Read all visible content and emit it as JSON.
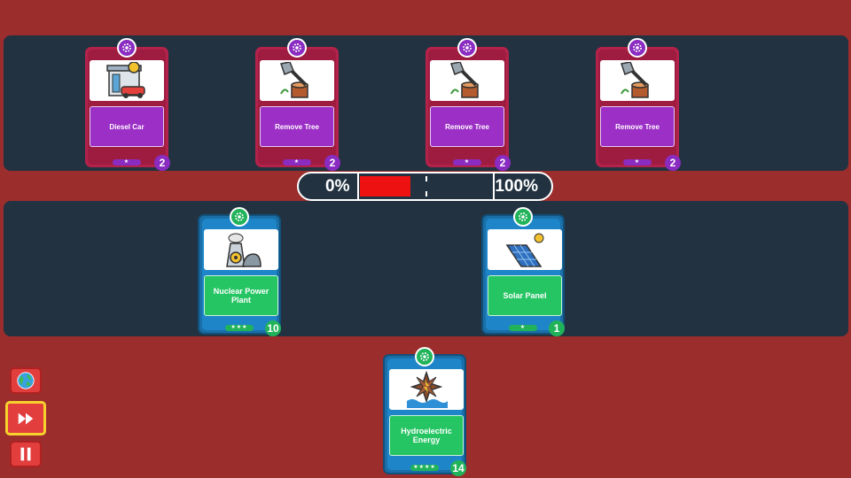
{
  "enemy_cards": [
    {
      "title": "Diesel Car",
      "icon": "diesel-car-icon",
      "count": "2",
      "stars": "★"
    },
    {
      "title": "Remove Tree",
      "icon": "axe-stump-icon",
      "count": "2",
      "stars": "★"
    },
    {
      "title": "Remove Tree",
      "icon": "axe-stump-icon",
      "count": "2",
      "stars": "★"
    },
    {
      "title": "Remove Tree",
      "icon": "axe-stump-icon",
      "count": "2",
      "stars": "★"
    }
  ],
  "progress": {
    "left_label": "0%",
    "right_label": "100%",
    "fill_fraction": 0.38,
    "fill_color": "#ee1111"
  },
  "player_cards": [
    {
      "title": "Nuclear Power Plant",
      "icon": "nuclear-plant-icon",
      "count": "10",
      "stars": "★★★"
    },
    {
      "title": "Solar Panel",
      "icon": "solar-panel-icon",
      "count": "1",
      "stars": "★"
    }
  ],
  "hand_card": {
    "title": "Hydroelectric Energy",
    "icon": "hydro-turbine-icon",
    "count": "14",
    "stars": "★★★★"
  },
  "controls": [
    {
      "name": "globe-button",
      "icon": "globe-icon"
    },
    {
      "name": "fast-forward-button",
      "icon": "fast-forward-icon",
      "selected": true
    },
    {
      "name": "pause-button",
      "icon": "pause-icon"
    }
  ],
  "colors": {
    "background": "#9b2d2d",
    "lane": "#223240",
    "enemy_card": "#b3224a",
    "enemy_accent": "#9b2fc6",
    "player_card": "#1e86c8",
    "player_accent": "#26c563"
  }
}
